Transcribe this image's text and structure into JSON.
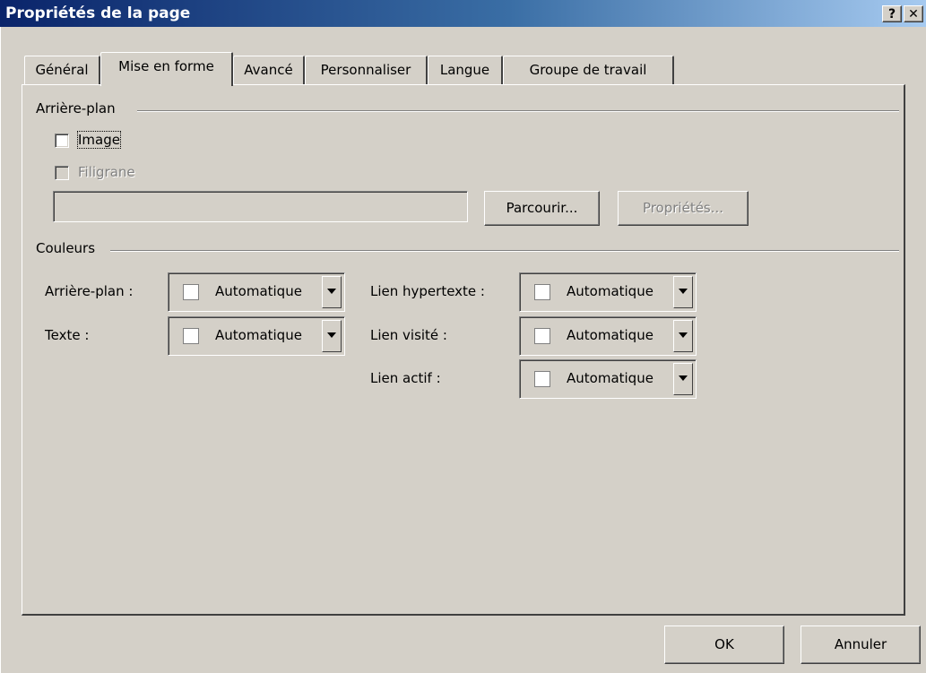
{
  "window": {
    "title": "Propriétés de la page",
    "help_glyph": "?",
    "close_glyph": "✕"
  },
  "tabs": [
    {
      "label": "Général"
    },
    {
      "label": "Mise en forme"
    },
    {
      "label": "Avancé"
    },
    {
      "label": "Personnaliser"
    },
    {
      "label": "Langue"
    },
    {
      "label": "Groupe de travail"
    }
  ],
  "background_group": {
    "title": "Arrière-plan",
    "image_checkbox": {
      "label": "Image",
      "checked": false
    },
    "watermark_checkbox": {
      "label": "Filigrane",
      "checked": false,
      "enabled": false
    },
    "path_value": "",
    "browse_button": "Parcourir...",
    "properties_button": "Propriétés..."
  },
  "colors_group": {
    "title": "Couleurs",
    "fields": [
      {
        "label": "Arrière-plan :",
        "value": "Automatique"
      },
      {
        "label": "Texte :",
        "value": "Automatique"
      },
      {
        "label": "Lien hypertexte :",
        "value": "Automatique"
      },
      {
        "label": "Lien visité :",
        "value": "Automatique"
      },
      {
        "label": "Lien actif :",
        "value": "Automatique"
      }
    ],
    "swatch_color": "#ffffff"
  },
  "footer": {
    "ok_button": "OK",
    "cancel_button": "Annuler"
  }
}
